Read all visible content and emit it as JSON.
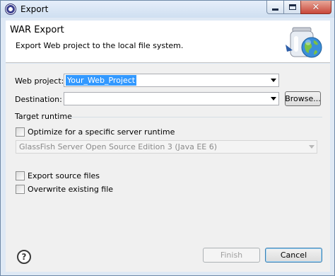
{
  "window": {
    "title": "Export",
    "app_icon": "eclipse-icon"
  },
  "header": {
    "title": "WAR Export",
    "description": "Export Web project to the local file system.",
    "icon": "war-export-icon"
  },
  "form": {
    "web_project_label": "Web project:",
    "web_project_value": "Your_Web_Project",
    "destination_label": "Destination:",
    "destination_value": "",
    "browse_label": "Browse...",
    "target_runtime_label": "Target runtime",
    "optimize_label": "Optimize for a specific server runtime",
    "optimize_checked": false,
    "runtime_value": "GlassFish Server Open Source Edition 3 (Java EE 6)",
    "export_source_label": "Export source files",
    "export_source_checked": false,
    "overwrite_label": "Overwrite existing file",
    "overwrite_checked": false
  },
  "footer": {
    "help_icon": "help-icon",
    "finish_label": "Finish",
    "cancel_label": "Cancel"
  }
}
